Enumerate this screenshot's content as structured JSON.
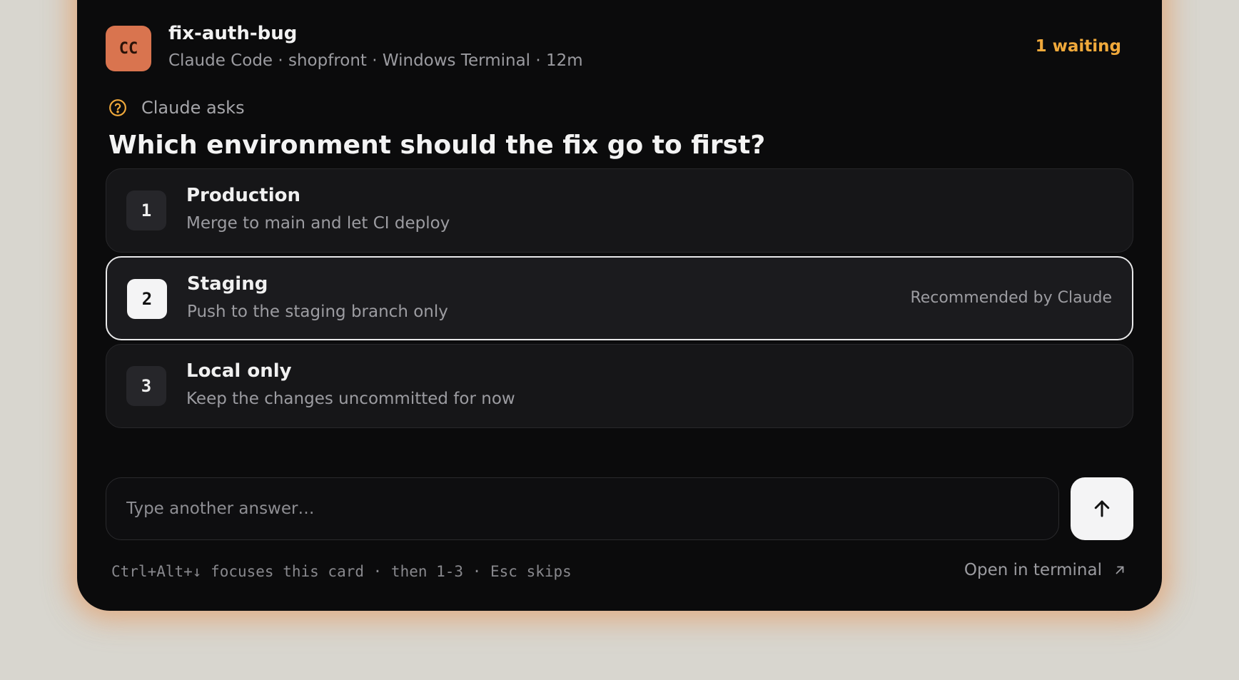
{
  "session": {
    "avatar_initials": "CC",
    "title": "fix-auth-bug",
    "subtitle": "Claude Code · shopfront · Windows Terminal · 12m",
    "waiting": "1 waiting"
  },
  "prompt": {
    "label": "Claude asks",
    "label_icon": "question-circle-icon",
    "question": "Which environment should the fix go to first?"
  },
  "options": [
    {
      "number": "1",
      "label": "Production",
      "description": "Merge to main and let CI deploy",
      "badge": ""
    },
    {
      "number": "2",
      "label": "Staging",
      "description": "Push to the staging branch only",
      "badge": "Recommended by Claude",
      "selected": true
    },
    {
      "number": "3",
      "label": "Local only",
      "description": "Keep the changes uncommitted for now",
      "badge": ""
    }
  ],
  "answer": {
    "placeholder": "Type another answer…",
    "value": "",
    "send_icon": "arrow-up-icon"
  },
  "footer": {
    "hint": "Ctrl+Alt+↓ focuses this card · then 1-3 · Esc skips",
    "open_terminal": "Open in terminal",
    "open_terminal_icon": "arrow-up-right-icon"
  },
  "colors": {
    "accent_waiting": "#f0a93b",
    "avatar_bg": "#d9744f",
    "card_bg": "#0b0b0c",
    "glow": "#e29e6a",
    "page_bg": "#d8d6cf"
  }
}
